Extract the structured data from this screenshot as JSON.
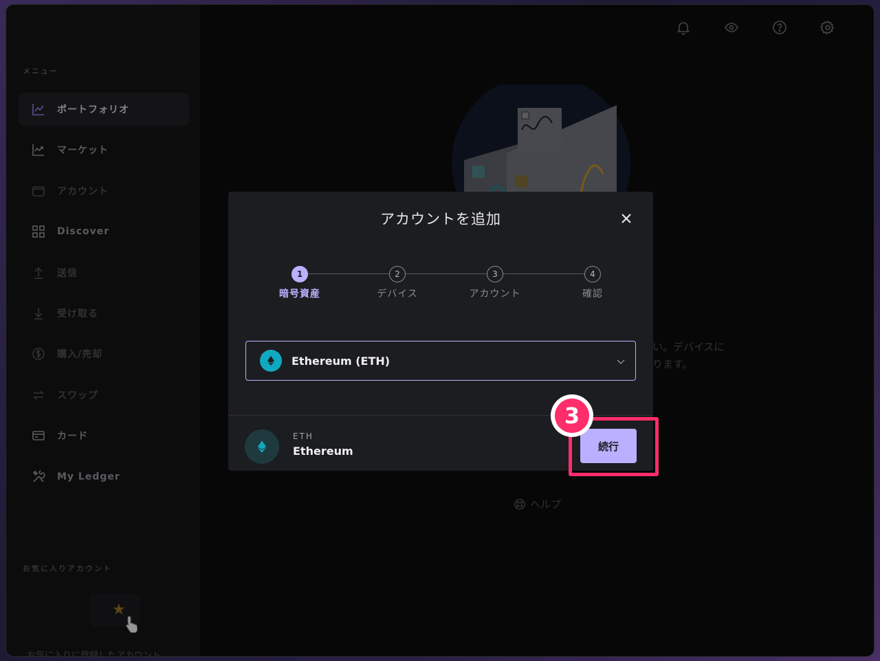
{
  "sidebar": {
    "menu_label": "メニュー",
    "items": [
      {
        "label": "ポートフォリオ",
        "icon": "portfolio-chart-icon"
      },
      {
        "label": "マーケット",
        "icon": "market-chart-icon"
      },
      {
        "label": "アカウント",
        "icon": "wallet-icon"
      },
      {
        "label": "Discover",
        "icon": "grid-icon"
      },
      {
        "label": "送信",
        "icon": "arrow-up-icon"
      },
      {
        "label": "受け取る",
        "icon": "arrow-down-icon"
      },
      {
        "label": "購入/売却",
        "icon": "dollar-circle-icon"
      },
      {
        "label": "スワップ",
        "icon": "swap-icon"
      },
      {
        "label": "カード",
        "icon": "card-icon"
      },
      {
        "label": "My Ledger",
        "icon": "tools-icon"
      }
    ],
    "favorites_label": "お気に入りアカウント",
    "favorites_hint": "お気に入りに登録したアカウント"
  },
  "main": {
    "bg_text_line1": "い。デバイスに",
    "bg_text_line2": "ります。",
    "help_label": "ヘルプ"
  },
  "modal": {
    "title": "アカウントを追加",
    "steps": [
      {
        "num": "1",
        "label": "暗号資産"
      },
      {
        "num": "2",
        "label": "デバイス"
      },
      {
        "num": "3",
        "label": "アカウント"
      },
      {
        "num": "4",
        "label": "確認"
      }
    ],
    "selected_asset": "Ethereum (ETH)",
    "footer_ticker": "ETH",
    "footer_name": "Ethereum",
    "continue_label": "続行"
  },
  "annotation": {
    "step_number": "3",
    "highlight_color": "#ff2d6a"
  },
  "colors": {
    "accent": "#bbb0ff",
    "eth_teal": "#10a9bf"
  }
}
